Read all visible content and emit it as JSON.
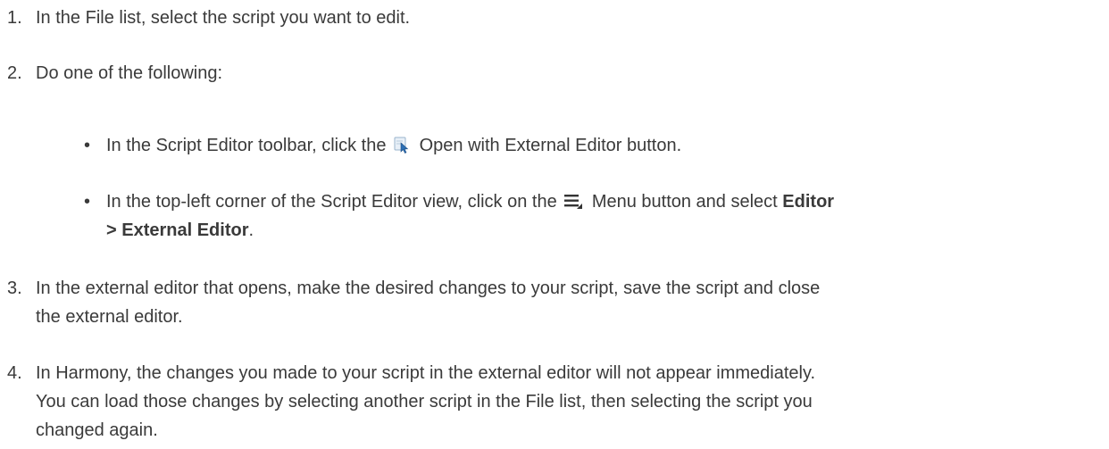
{
  "steps": [
    {
      "number": "1.",
      "text": "In the File list, select the script you want to edit."
    },
    {
      "number": "2.",
      "text": "Do one of the following:"
    },
    {
      "number": "3.",
      "line1": "In the external editor that opens, make the desired changes to your script, save the script and close",
      "line2": "the external editor."
    },
    {
      "number": "4.",
      "line1": "In Harmony, the changes you made to your script in the external editor will not appear immediately.",
      "line2": "You can load those changes by selecting another script in the File list, then selecting the script you",
      "line3": "changed again."
    }
  ],
  "bullets": [
    {
      "marker": "•",
      "before": "In the Script Editor toolbar, click the",
      "after": "Open with External Editor button.",
      "icon": "external-editor-icon"
    },
    {
      "marker": "•",
      "before": "In the top-left corner of the Script Editor view, click on the",
      "after": "Menu button and select",
      "bold1": "Editor",
      "bold2": "> External Editor",
      "end": ".",
      "icon": "menu-icon"
    }
  ]
}
